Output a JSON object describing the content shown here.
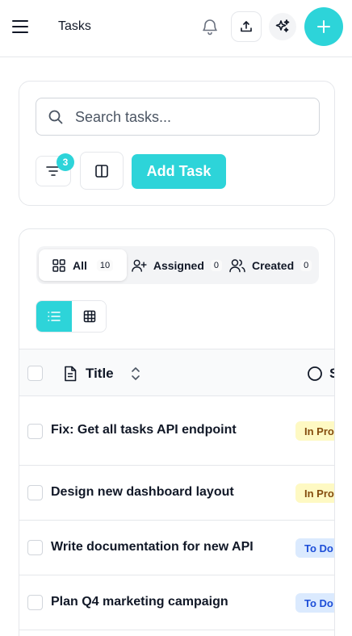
{
  "header": {
    "title": "Tasks",
    "icons": {
      "menu": "menu-icon",
      "notifications": "bell-icon",
      "export": "upload-icon",
      "ai": "sparkles-icon",
      "create": "plus-icon"
    },
    "accent_color": "#2dd4d9"
  },
  "toolbar": {
    "search_placeholder": "Search tasks...",
    "filter_count": "3",
    "add_task_label": "Add Task"
  },
  "tabs": [
    {
      "label": "All",
      "count": "10",
      "active": true
    },
    {
      "label": "Assigned",
      "count": "0",
      "active": false
    },
    {
      "label": "Created",
      "count": "0",
      "active": false
    }
  ],
  "view_toggle": {
    "selected": "list"
  },
  "table": {
    "columns": [
      {
        "label": "Title"
      },
      {
        "label": "S"
      }
    ],
    "rows": [
      {
        "title": "Fix: Get all tasks API endpoint",
        "status": "In Pro"
      },
      {
        "title": "Design new dashboard layout",
        "status": "In Pro"
      },
      {
        "title": "Write documentation for new API",
        "status": "To Do"
      },
      {
        "title": "Plan Q4 marketing campaign",
        "status": "To Do"
      }
    ]
  }
}
